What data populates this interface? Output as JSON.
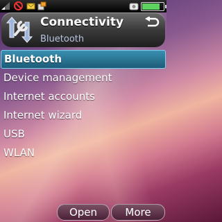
{
  "header": {
    "title": "Connectivity",
    "subtitle": "Bluetooth"
  },
  "menu": {
    "items": [
      {
        "label": "Bluetooth",
        "selected": true
      },
      {
        "label": "Device management"
      },
      {
        "label": "Internet accounts"
      },
      {
        "label": "Internet wizard"
      },
      {
        "label": "USB"
      },
      {
        "label": "WLAN"
      }
    ]
  },
  "softkeys": {
    "open": "Open",
    "more": "More"
  },
  "status": {
    "icons": [
      "signal-icon",
      "mute-icon",
      "message-icon",
      "network-icon",
      "camera-icon",
      "battery-icon"
    ],
    "battery_level": 0.85
  },
  "colors": {
    "selection": "#2a7a9a",
    "header": "#3a3a3a"
  }
}
